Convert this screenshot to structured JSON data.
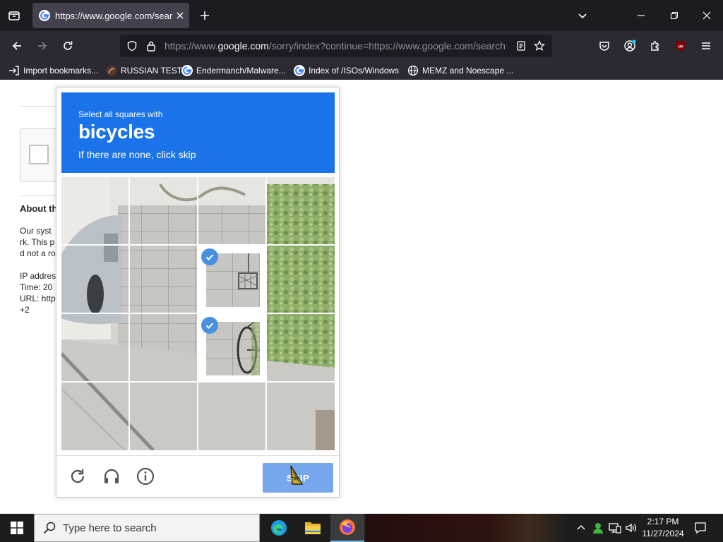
{
  "browser": {
    "tab_title": "https://www.google.com/search",
    "url_prefix": "https://www.",
    "url_host": "google.com",
    "url_rest": "/sorry/index?continue=https://www.google.com/search",
    "bookmarks": [
      {
        "label": "Import bookmarks...",
        "icon": "import-icon"
      },
      {
        "label": "RUSSIAN TEST",
        "icon": "site-icon"
      },
      {
        "label": "Endermanch/Malware...",
        "icon": "google-icon"
      },
      {
        "label": "Index of /ISOs/Windows",
        "icon": "google-icon"
      },
      {
        "label": "MEMZ and Noescape ...",
        "icon": "globe-icon"
      }
    ]
  },
  "page": {
    "about_heading": "About th",
    "line1": "Our syst",
    "line2": "rk. This p",
    "line3": "d not a ro",
    "ip": "IP addres",
    "time": "Time: 20",
    "url": "URL: http",
    "extra": "+2"
  },
  "captcha": {
    "line1": "Select all squares with",
    "target": "bicycles",
    "line3": "If there are none, click skip",
    "skip_label": "SKIP",
    "tiles_selected": [
      6,
      10
    ],
    "colors": {
      "header": "#1a73e8",
      "skip": "#76a7ec",
      "tick": "#4a90e2"
    }
  },
  "taskbar": {
    "search_placeholder": "Type here to search",
    "time": "2:17 PM",
    "date": "11/27/2024"
  }
}
